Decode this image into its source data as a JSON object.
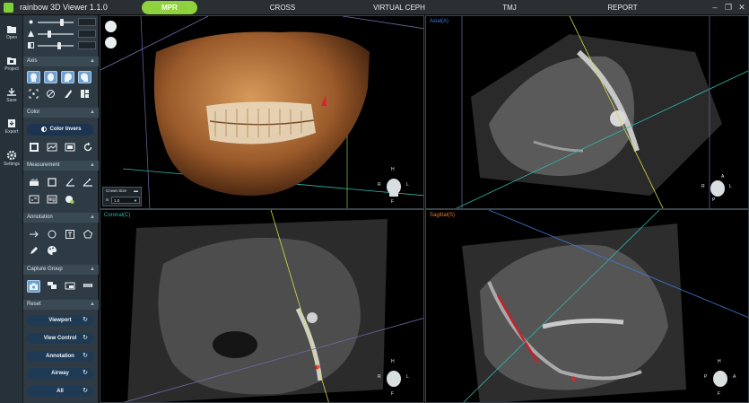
{
  "app": {
    "title": "rainbow 3D Viewer 1.1.0"
  },
  "tabs": [
    {
      "label": "MPR",
      "active": true
    },
    {
      "label": "CROSS"
    },
    {
      "label": "VIRTUAL CEPH"
    },
    {
      "label": "TMJ"
    },
    {
      "label": "REPORT"
    }
  ],
  "window_controls": {
    "min": "–",
    "restore": "❐",
    "close": "✕"
  },
  "leftbar": {
    "items": [
      {
        "label": "Open",
        "icon": "folder-icon"
      },
      {
        "label": "Project",
        "icon": "project-folder-icon"
      },
      {
        "label": "Save",
        "icon": "save-icon"
      },
      {
        "label": "Export",
        "icon": "export-icon"
      },
      {
        "label": "Settings",
        "icon": "gear-icon"
      }
    ]
  },
  "panel": {
    "sections": {
      "axis": "Axis",
      "color": "Color",
      "measurement": "Measurement",
      "annotation": "Annotation",
      "capture_group": "Capture Group",
      "reset": "Reset"
    },
    "color_invert_label": "Color Invers",
    "reset_buttons": [
      "Viewport",
      "View Control",
      "Annotation",
      "Airway",
      "All"
    ]
  },
  "viewports": {
    "volume": {
      "crown_size": {
        "title": "Crown Size",
        "dash": "▬",
        "s_label": "S",
        "value": "1.0"
      }
    },
    "axial": {
      "label": "Axial(A)"
    },
    "coronal": {
      "label": "Coronal(C)"
    },
    "sagittal": {
      "label": "Sagittal(S)"
    }
  },
  "orientation": {
    "volume": {
      "top": "H",
      "left": "R",
      "right": "L",
      "bottom": "F"
    },
    "axial": {
      "top": "A",
      "left": "R",
      "right": "L",
      "bottom": "P"
    },
    "coronal": {
      "top": "H",
      "left": "R",
      "right": "L",
      "bottom": "F"
    },
    "sagittal": {
      "top": "H",
      "left": "P",
      "right": "A",
      "bottom": "F"
    }
  },
  "colors": {
    "accent": "#8ed23e",
    "axial": "#3f7bd9",
    "coronal": "#2fb8a8",
    "sagittal": "#e07a2a"
  }
}
